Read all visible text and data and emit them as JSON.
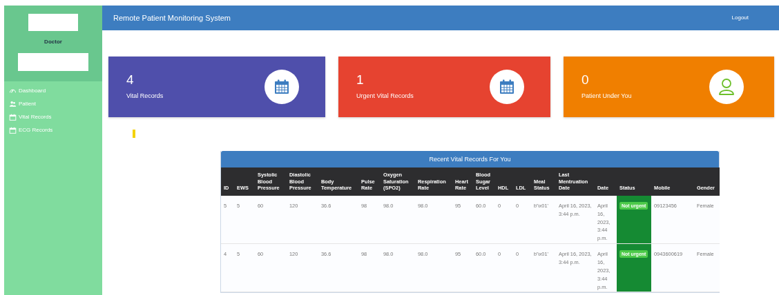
{
  "sidebar": {
    "role": "Doctor",
    "items": [
      {
        "label": "Dashboard",
        "kind": "gauge"
      },
      {
        "label": "Patient",
        "kind": "users"
      },
      {
        "label": "Vital Records",
        "kind": "calendar"
      },
      {
        "label": "ECG Records",
        "kind": "calendar"
      }
    ]
  },
  "topbar": {
    "title": "Remote Patient Monitoring System",
    "logout": "Logout"
  },
  "cards": [
    {
      "count": "4",
      "label": "Vital Records",
      "color": "#4f4fab",
      "kind": "calendar"
    },
    {
      "count": "1",
      "label": "Urgent Vital Records",
      "color": "#e64330",
      "kind": "calendar"
    },
    {
      "count": "0",
      "label": "Patient Under You",
      "color": "#f07f00",
      "kind": "user"
    }
  ],
  "table": {
    "title": "Recent Vital Records For You",
    "columns": [
      "ID",
      "EWS",
      "Systolic Blood Pressure",
      "Diastolic Blood Pressure",
      "Body Temperature",
      "Pulse Rate",
      "Oxygen Saturation (SPO2)",
      "Respiration Rate",
      "Heart Rate",
      "Blood Sugar Level",
      "HDL",
      "LDL",
      "Meal Status",
      "Last Mentruation Date",
      "Date",
      "Status",
      "Mobile",
      "Gender"
    ],
    "rows": [
      {
        "cells": [
          "5",
          "5",
          "60",
          "120",
          "36.6",
          "98",
          "98.0",
          "98.0",
          "95",
          "60.0",
          "0",
          "0",
          "b'\\x01'",
          "April 16, 2023, 3:44 p.m.",
          "April 16, 2023, 3:44 p.m.",
          {
            "label": "Not urgent",
            "kind": "not_urgent"
          },
          "09123456",
          "Female"
        ]
      },
      {
        "cells": [
          "4",
          "5",
          "60",
          "120",
          "36.6",
          "98",
          "98.0",
          "98.0",
          "95",
          "60.0",
          "0",
          "0",
          "b'\\x01'",
          "April 16, 2023, 3:44 p.m.",
          "April 16, 2023, 3:44 p.m.",
          {
            "label": "Not urgent",
            "kind": "not_urgent"
          },
          "0943600619",
          "Female"
        ]
      }
    ]
  }
}
